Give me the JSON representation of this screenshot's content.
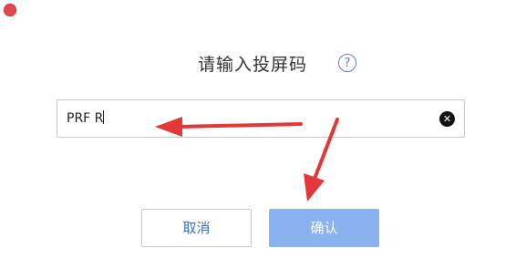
{
  "window": {
    "close_icon": "close-icon"
  },
  "dialog": {
    "title": "请输入投屏码",
    "help_icon_glyph": "?",
    "input": {
      "value": "PRF R"
    },
    "clear_icon_glyph": "✕",
    "cancel_label": "取消",
    "confirm_label": "确认"
  },
  "colors": {
    "accent": "#3a6fd0",
    "confirm_bg": "#8ab2f0",
    "annotation_arrow": "#e5363a"
  }
}
